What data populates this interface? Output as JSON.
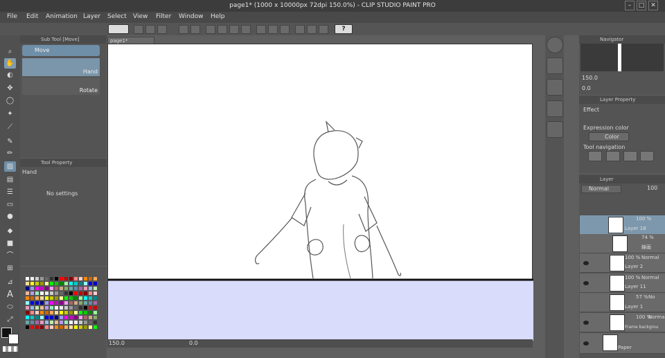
{
  "window": {
    "title": "page1* (1000 x 10000px 72dpi 150.0%) - CLIP STUDIO PAINT PRO"
  },
  "menu": [
    "File",
    "Edit",
    "Animation",
    "Layer",
    "Select",
    "View",
    "Filter",
    "Window",
    "Help"
  ],
  "subtool": {
    "header": "Sub Tool [Move]",
    "group": "Move",
    "items": [
      "Hand",
      "Rotate"
    ]
  },
  "toolprop": {
    "header": "Tool Property",
    "name": "Hand",
    "empty": "No settings"
  },
  "canvas": {
    "tab": "page1*",
    "zoom": "150.0",
    "rotation": "0.0"
  },
  "navigator": {
    "header": "Navigator",
    "zoom": "150.0",
    "rotation": "0.0"
  },
  "layerprop": {
    "header": "Layer Property",
    "effect": "Effect",
    "expression": "Expression color",
    "color": "Color",
    "toolnav": "Tool navigation"
  },
  "layers": {
    "header": "Layer",
    "blend": "Normal",
    "opacity": "100",
    "rows": [
      {
        "pct": "100 %",
        "mode": "",
        "name": "Layer 18"
      },
      {
        "pct": "74 %",
        "mode": "",
        "name": "線画"
      },
      {
        "pct": "100 %",
        "mode": "Normal",
        "name": "Layer 2"
      },
      {
        "pct": "100 %",
        "mode": "Normal",
        "name": "Layer 11"
      },
      {
        "pct": "57 %",
        "mode": "No",
        "name": "Layer 1"
      },
      {
        "pct": "100 %",
        "mode": "Normal",
        "name": "Frame backgrou"
      },
      {
        "pct": "",
        "mode": "",
        "name": "Paper"
      }
    ]
  },
  "colors": {
    "canvas_bg": "#dadcfc",
    "accent": "#6f8fa8"
  }
}
